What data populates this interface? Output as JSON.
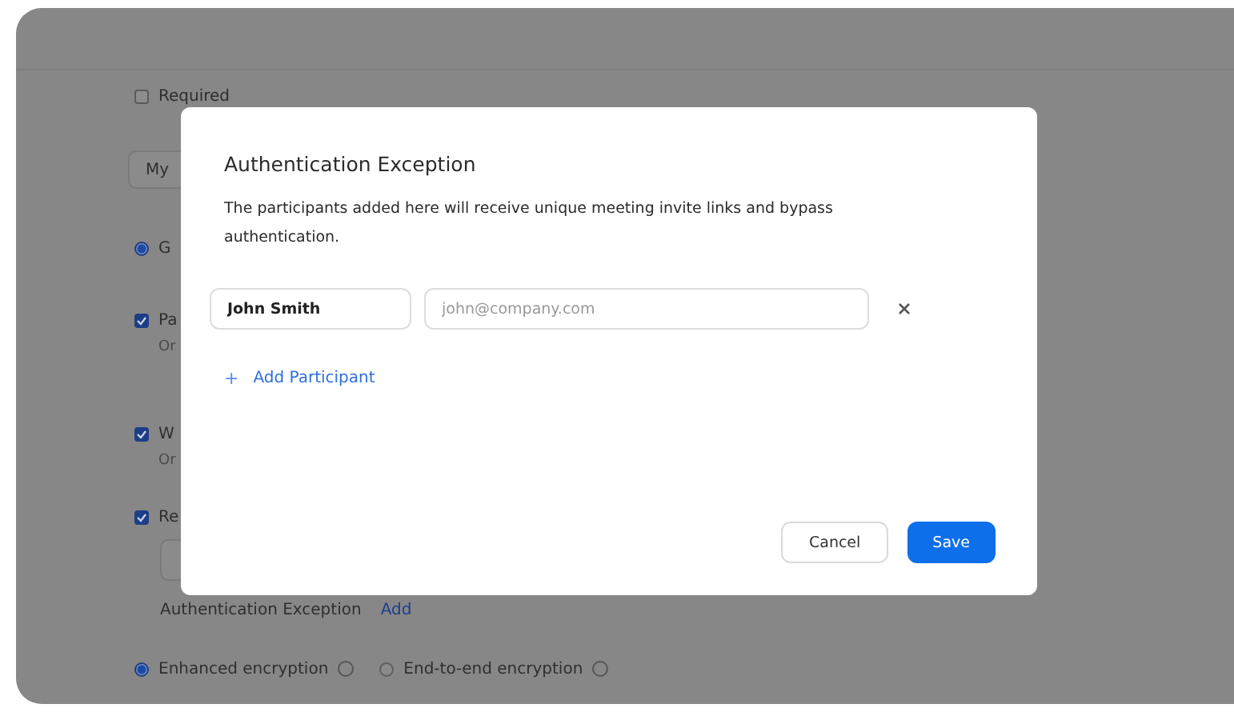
{
  "settings": {
    "required": {
      "label": "Required",
      "checked": false
    },
    "dropdown": {
      "value": "My"
    },
    "options": [
      {
        "kind": "radio",
        "label": "G",
        "selected": true
      },
      {
        "kind": "checkbox",
        "label": "Pa",
        "checked": true,
        "note": "Or"
      },
      {
        "kind": "checkbox",
        "label": "W",
        "checked": true,
        "note": "Or"
      },
      {
        "kind": "checkbox",
        "label": "Re",
        "checked": true,
        "field": true
      }
    ],
    "auth_exception": {
      "label": "Authentication Exception",
      "link": "Add"
    },
    "encryption": [
      {
        "label": "Enhanced encryption",
        "selected": true
      },
      {
        "label": "End-to-end encryption",
        "selected": false
      }
    ]
  },
  "dialog": {
    "title": "Authentication Exception",
    "description": "The participants added here will receive unique meeting invite links and bypass authentication.",
    "participants": [
      {
        "name": "John Smith",
        "email_placeholder": "john@company.com"
      }
    ],
    "add_participant": {
      "icon": "+",
      "label": "Add Participant"
    },
    "buttons": {
      "cancel": "Cancel",
      "save": "Save"
    }
  }
}
